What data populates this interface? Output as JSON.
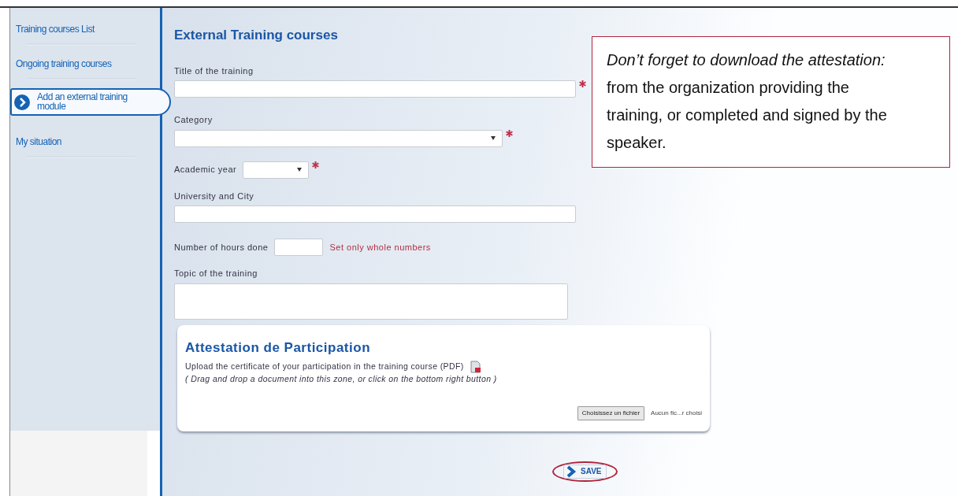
{
  "sidebar": {
    "items": [
      {
        "label": "Training courses List",
        "selected": false
      },
      {
        "label": "Ongoing training courses",
        "selected": false
      },
      {
        "label": "Add an external training module",
        "selected": true
      },
      {
        "label": "My situation",
        "selected": false
      }
    ]
  },
  "form": {
    "title": "External Training courses",
    "fields": [
      {
        "kind": "text",
        "label": "Title of the training",
        "required": true
      },
      {
        "kind": "select",
        "label": "Category",
        "required": true
      },
      {
        "kind": "short-select",
        "label": "Academic year",
        "required": true
      },
      {
        "kind": "text",
        "label": "University and City",
        "required": false
      },
      {
        "kind": "short-number",
        "label": "Number of hours done",
        "required": false,
        "hint": "Set only whole numbers"
      },
      {
        "kind": "textarea",
        "label": "Topic of the training",
        "required": false
      }
    ]
  },
  "upload": {
    "title": "Attestation de Participation",
    "description": "Upload the certificate of your participation in the training course (PDF)",
    "instruction": "( Drag and drop a document into this zone, or click on the bottom right button )",
    "button": "Choisissez un fichier",
    "file_status": "Aucun fic...r choisi"
  },
  "save": {
    "label": "SAVE",
    "highlighted": true
  },
  "note": {
    "text": "*Don’t forget to download the attestation:* from the organization providing the training, or completed and signed by the speaker."
  }
}
